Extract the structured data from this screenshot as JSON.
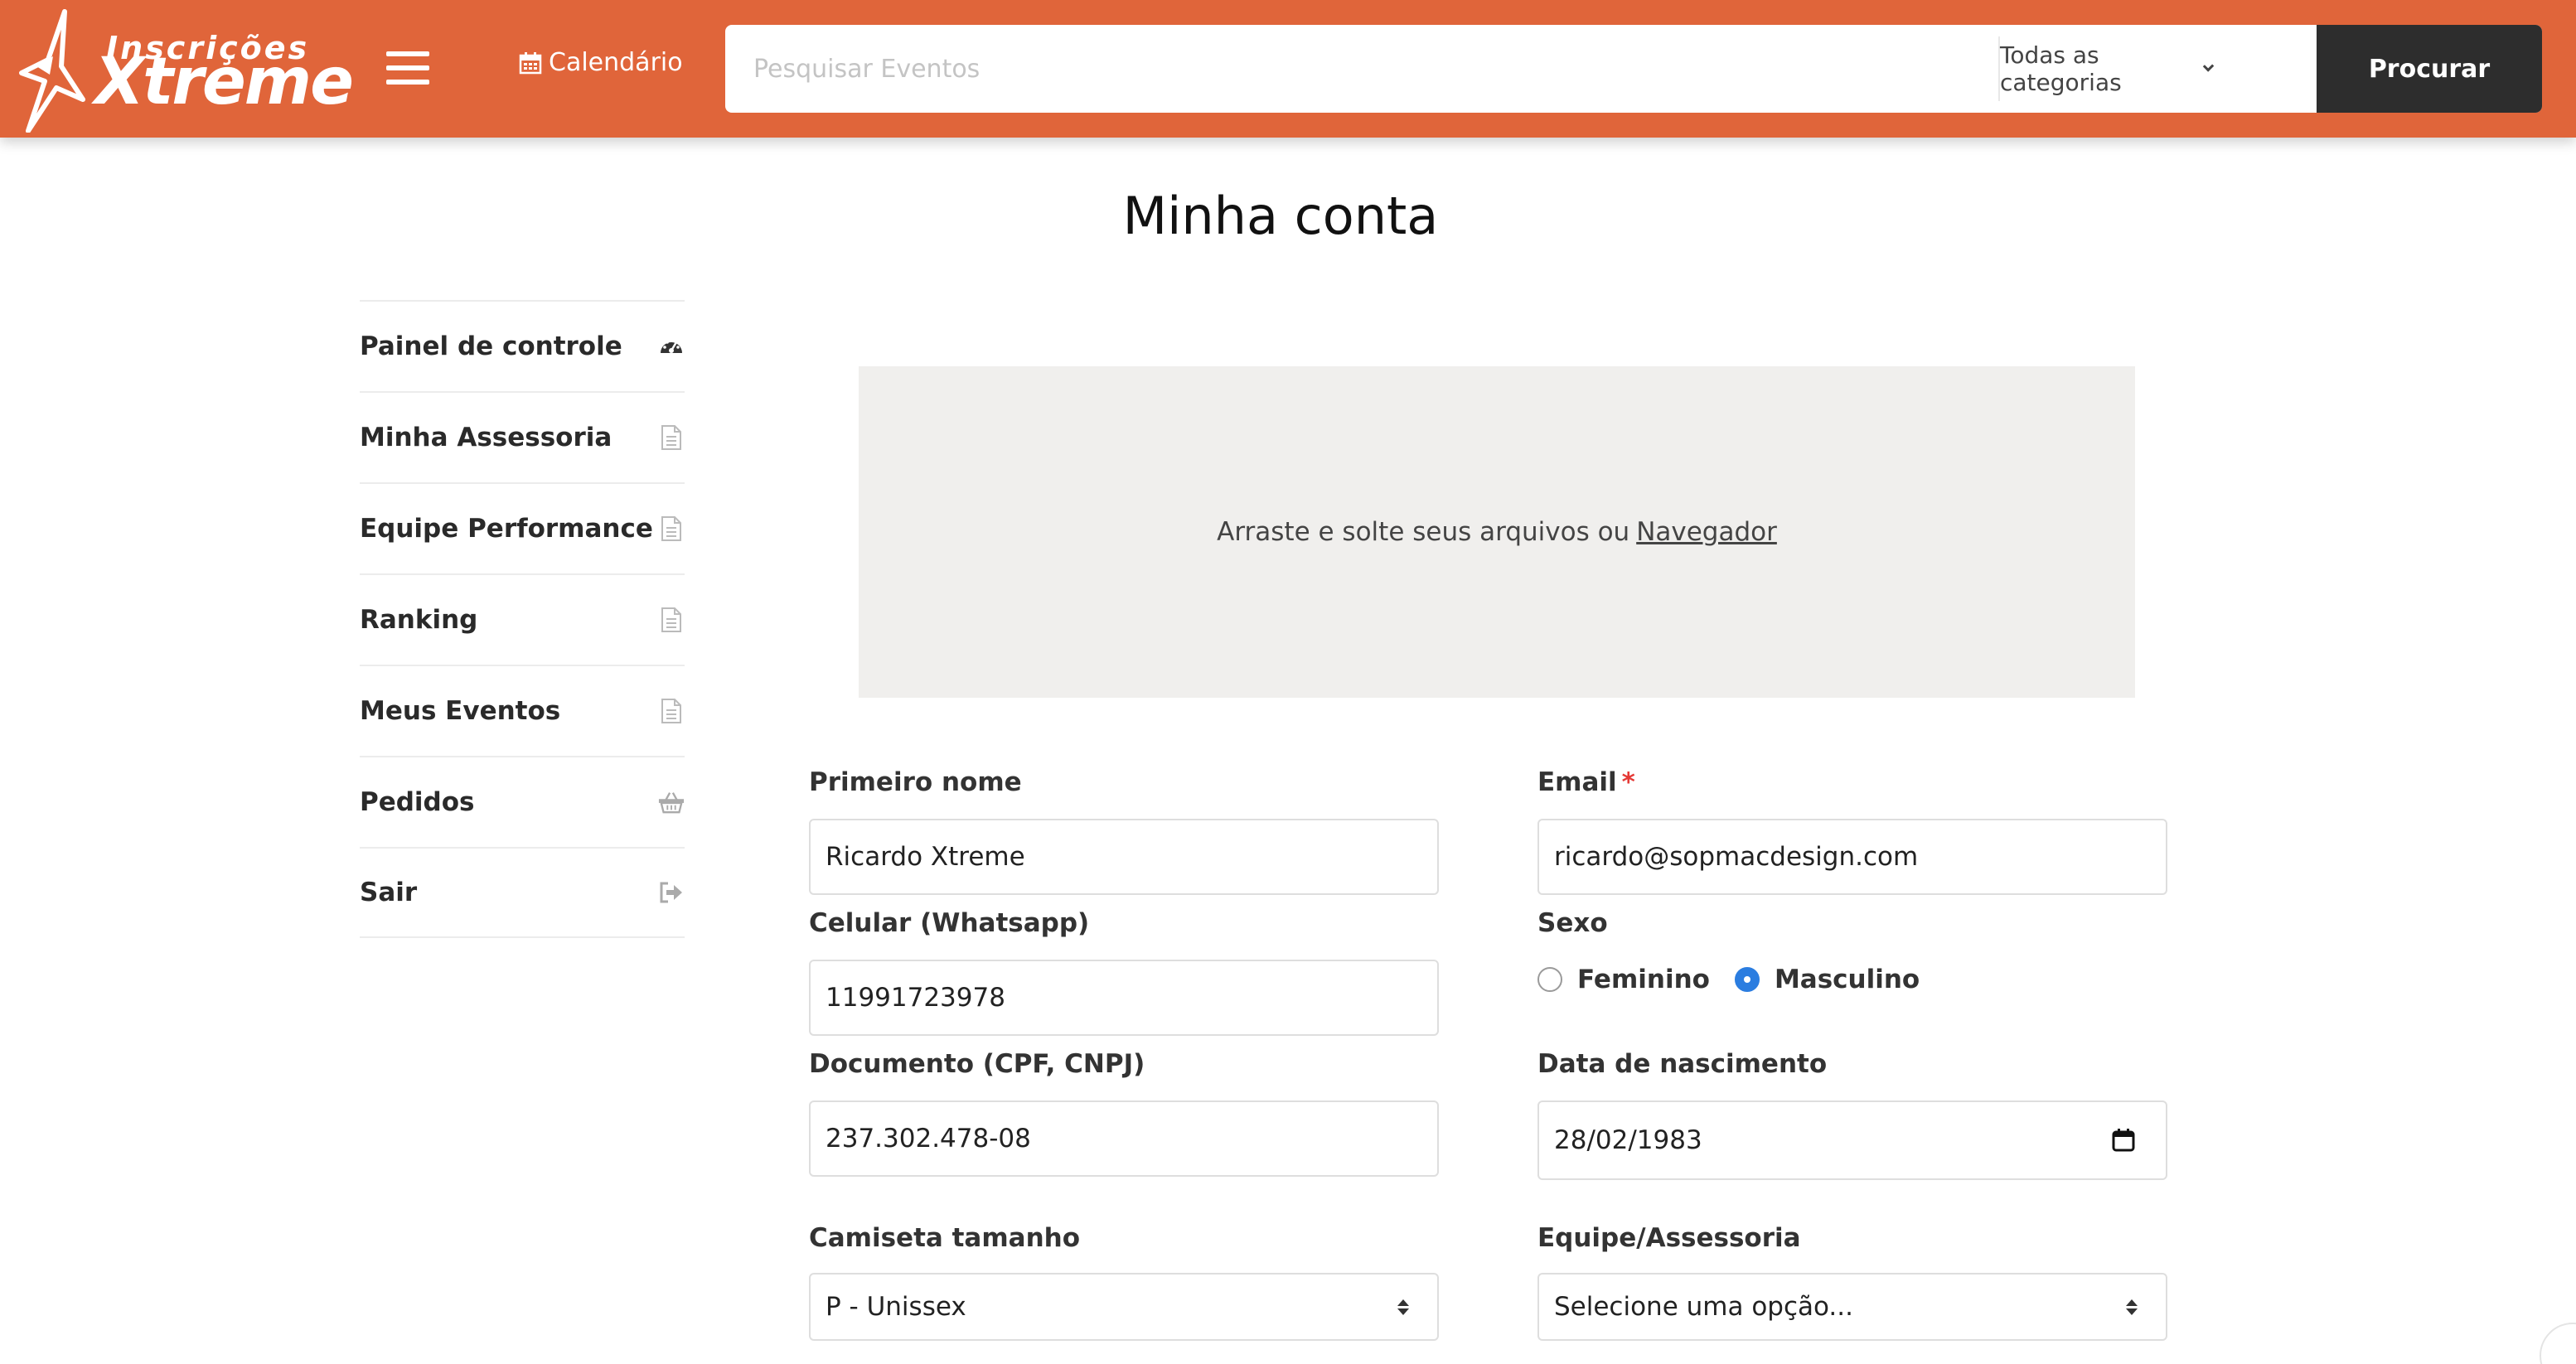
{
  "header": {
    "logo": {
      "line1": "Inscrições",
      "line2": "Xtreme"
    },
    "calendar_label": "Calendário",
    "search_placeholder": "Pesquisar Eventos",
    "category_select": "Todas as categorias",
    "search_button": "Procurar",
    "colors": {
      "brand": "#e0653a",
      "button": "#2d2d2d"
    }
  },
  "page": {
    "title": "Minha conta"
  },
  "sidebar": {
    "items": [
      {
        "label": "Painel de controle",
        "icon": "dashboard-icon"
      },
      {
        "label": "Minha Assessoria",
        "icon": "document-icon"
      },
      {
        "label": "Equipe Performance",
        "icon": "document-icon"
      },
      {
        "label": "Ranking",
        "icon": "document-icon"
      },
      {
        "label": "Meus Eventos",
        "icon": "document-icon"
      },
      {
        "label": "Pedidos",
        "icon": "basket-icon"
      },
      {
        "label": "Sair",
        "icon": "sign-out-icon"
      }
    ]
  },
  "dropzone": {
    "text": "Arraste e solte seus arquivos ou",
    "link": "Navegador"
  },
  "form": {
    "first_name": {
      "label": "Primeiro nome",
      "value": "Ricardo Xtreme"
    },
    "email": {
      "label": "Email",
      "required_mark": "*",
      "value": "ricardo@sopmacdesign.com"
    },
    "phone": {
      "label": "Celular (Whatsapp)",
      "value": "11991723978"
    },
    "sex": {
      "label": "Sexo",
      "options": [
        "Feminino",
        "Masculino"
      ],
      "selected": "Masculino"
    },
    "document": {
      "label": "Documento (CPF, CNPJ)",
      "value": "237.302.478-08"
    },
    "birth_date": {
      "label": "Data de nascimento",
      "value": "28/02/1983"
    },
    "shirt_size": {
      "label": "Camiseta tamanho",
      "value": "P - Unissex"
    },
    "team": {
      "label": "Equipe/Assessoria",
      "value": "Selecione uma opção..."
    }
  }
}
